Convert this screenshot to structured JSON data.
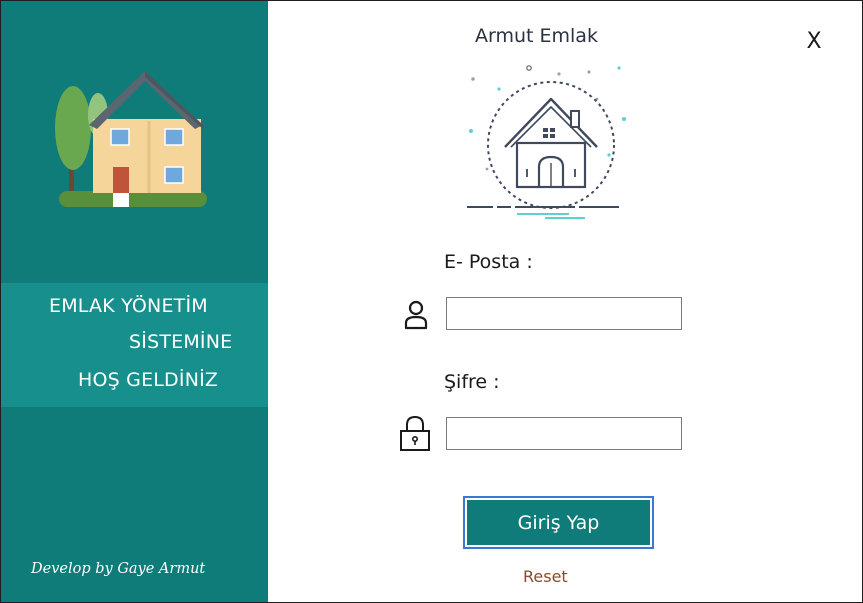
{
  "window": {
    "close_label": "X"
  },
  "brand": {
    "title": "Armut Emlak"
  },
  "welcome": {
    "line1": "EMLAK YÖNETİM",
    "line2": "SİSTEMİNE",
    "line3": "HOŞ GELDİNİZ"
  },
  "credit": "Develop by Gaye Armut",
  "form": {
    "email_label": "E- Posta :",
    "email_value": "",
    "password_label": "Şifre :",
    "password_value": "",
    "login_label": "Giriş Yap",
    "reset_label": "Reset"
  },
  "icons": {
    "house": "house-illustration",
    "logo": "house-logo-icon",
    "user": "user-icon",
    "lock": "lock-icon"
  },
  "colors": {
    "sidebar": "#0f7c7a",
    "welcome_band": "#17908d",
    "button": "#0f7c7a",
    "button_border": "#3a78d8",
    "reset_link": "#8b4a2b"
  }
}
